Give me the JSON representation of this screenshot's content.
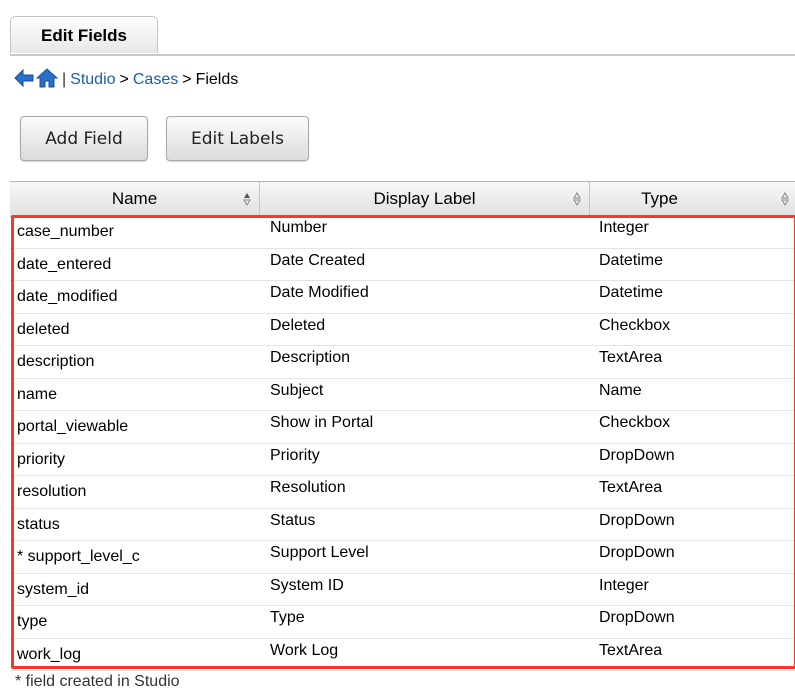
{
  "tabs": {
    "active_label": "Edit Fields"
  },
  "breadcrumb": {
    "separator": "|",
    "items": [
      "Studio",
      "Cases",
      "Fields"
    ],
    "arrow": ">"
  },
  "toolbar": {
    "add_field_label": "Add Field",
    "edit_labels_label": "Edit Labels"
  },
  "table": {
    "columns": [
      "Name",
      "Display Label",
      "Type"
    ],
    "rows": [
      {
        "name": "case_number",
        "label": "Number",
        "type": "Integer"
      },
      {
        "name": "date_entered",
        "label": "Date Created",
        "type": "Datetime"
      },
      {
        "name": "date_modified",
        "label": "Date Modified",
        "type": "Datetime"
      },
      {
        "name": "deleted",
        "label": "Deleted",
        "type": "Checkbox"
      },
      {
        "name": "description",
        "label": "Description",
        "type": "TextArea"
      },
      {
        "name": "name",
        "label": "Subject",
        "type": "Name"
      },
      {
        "name": "portal_viewable",
        "label": "Show in Portal",
        "type": "Checkbox"
      },
      {
        "name": "priority",
        "label": "Priority",
        "type": "DropDown"
      },
      {
        "name": "resolution",
        "label": "Resolution",
        "type": "TextArea"
      },
      {
        "name": "status",
        "label": "Status",
        "type": "DropDown"
      },
      {
        "name": "* support_level_c",
        "label": "Support Level",
        "type": "DropDown"
      },
      {
        "name": "system_id",
        "label": "System ID",
        "type": "Integer"
      },
      {
        "name": "type",
        "label": "Type",
        "type": "DropDown"
      },
      {
        "name": "work_log",
        "label": "Work Log",
        "type": "TextArea"
      }
    ]
  },
  "footnote": "* field created in Studio",
  "colors": {
    "link": "#1d5cab",
    "highlight": "#f03c2b"
  },
  "icons": [
    "back-arrow-icon",
    "home-icon",
    "sort-icon"
  ]
}
